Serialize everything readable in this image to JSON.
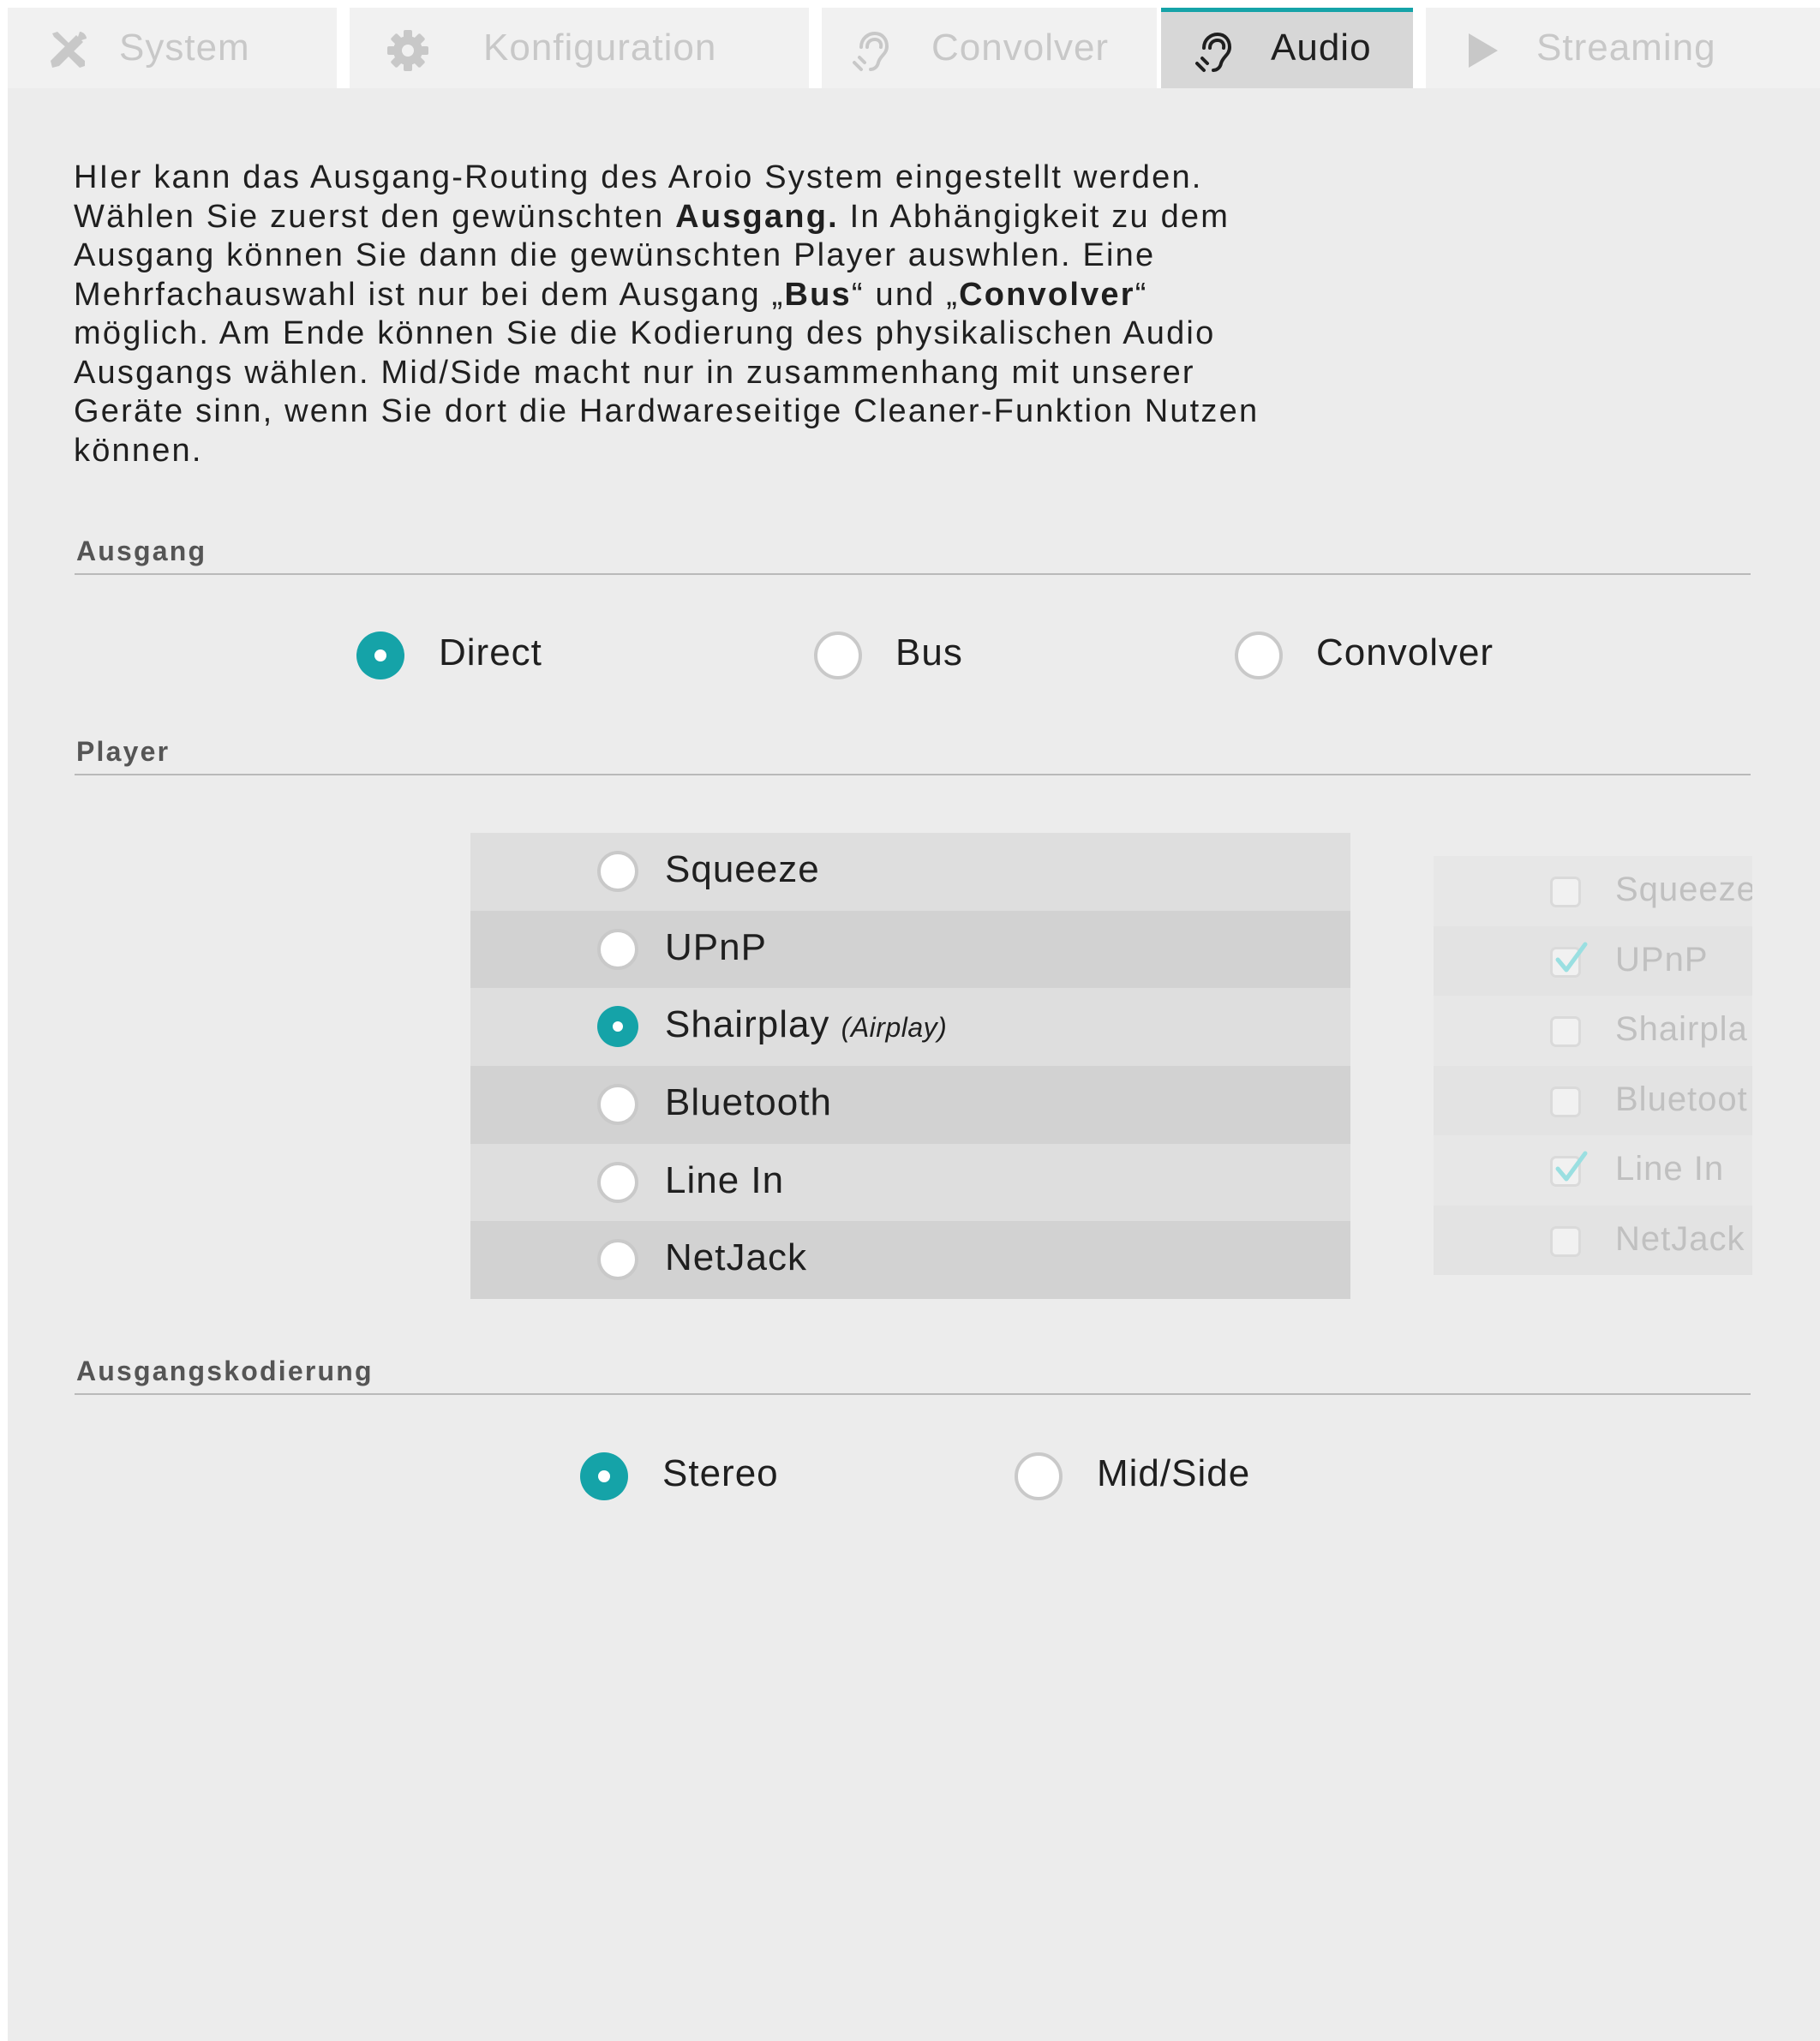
{
  "tabs": [
    {
      "label": "System",
      "icon": "tools-icon",
      "active": false
    },
    {
      "label": "Konfiguration",
      "icon": "gear-icon",
      "active": false
    },
    {
      "label": "Convolver",
      "icon": "ear-icon",
      "active": false
    },
    {
      "label": "Audio",
      "icon": "ear-icon",
      "active": true
    },
    {
      "label": "Streaming",
      "icon": "play-icon",
      "active": false
    }
  ],
  "intro": {
    "line1": "HIer kann das Ausgang-Routing des Aroio System eingestellt werden.",
    "line2_pre": "Wählen Sie zuerst den gewünschten ",
    "line2_bold": "Ausgang.",
    "line2_post": " In Abhängigkeit zu dem",
    "line3": "Ausgang können Sie dann die gewünschten Player auswhlen. Eine",
    "line4_pre": "Mehrfachauswahl ist nur bei dem Ausgang „",
    "line4_bold1": "Bus",
    "line4_mid": "“ und „",
    "line4_bold2": "Convolver",
    "line4_post": "“",
    "line5": "möglich. Am Ende können Sie die Kodierung des physikalischen Audio",
    "line6": "Ausgangs wählen. Mid/Side macht nur in zusammenhang mit unserer",
    "line7": "Geräte sinn, wenn Sie dort die Hardwareseitige Cleaner-Funktion Nutzen",
    "line8": "können."
  },
  "ausgang": {
    "title": "Ausgang",
    "options": [
      {
        "label": "Direct",
        "selected": true
      },
      {
        "label": "Bus",
        "selected": false
      },
      {
        "label": "Convolver",
        "selected": false
      }
    ]
  },
  "player": {
    "title": "Player",
    "options": [
      {
        "label": "Squeeze",
        "sub": "",
        "selected": false
      },
      {
        "label": "UPnP",
        "sub": "",
        "selected": false
      },
      {
        "label": "Shairplay",
        "sub": "(Airplay)",
        "selected": true
      },
      {
        "label": "Bluetooth",
        "sub": "",
        "selected": false
      },
      {
        "label": "Line In",
        "sub": "",
        "selected": false
      },
      {
        "label": "NetJack",
        "sub": "",
        "selected": false
      }
    ],
    "multi": [
      {
        "label": "Squeeze",
        "checked": false
      },
      {
        "label": "UPnP",
        "checked": true
      },
      {
        "label": "Shairpla",
        "checked": false
      },
      {
        "label": "Bluetoot",
        "checked": false
      },
      {
        "label": "Line In",
        "checked": true
      },
      {
        "label": "NetJack",
        "checked": false
      }
    ]
  },
  "kodierung": {
    "title": "Ausgangskodierung",
    "options": [
      {
        "label": "Stereo",
        "selected": true
      },
      {
        "label": "Mid/Side",
        "selected": false
      }
    ]
  },
  "colors": {
    "accent": "#15a3a8",
    "panel": "#ececec",
    "tab_inactive": "#f1f1f1",
    "tab_active": "#d7d7d7"
  }
}
